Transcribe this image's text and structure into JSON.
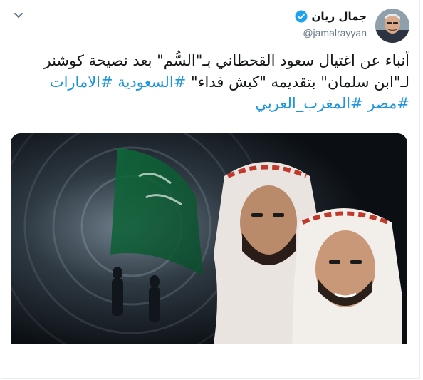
{
  "author": {
    "display_name": "جمال ريان",
    "handle": "@jamalrayyan",
    "verified": true
  },
  "tweet": {
    "line1": "أنباء عن اغتيال سعود القحطاني بـ\"السُّم\" بعد نصيحة كوشنر",
    "line2_text": "لـ\"ابن سلمان\" بتقديمه \"كبش فداء\" ",
    "hashtags_line2": [
      "#السعودية",
      "#الامارات"
    ],
    "hashtags_line3": [
      "#مصر",
      "#المغرب_العربي"
    ]
  },
  "media": {
    "description_icon": "photo-collage"
  },
  "colors": {
    "link": "#1b95e0",
    "text": "#14171a",
    "secondary": "#657786",
    "verified": "#1da1f2"
  }
}
